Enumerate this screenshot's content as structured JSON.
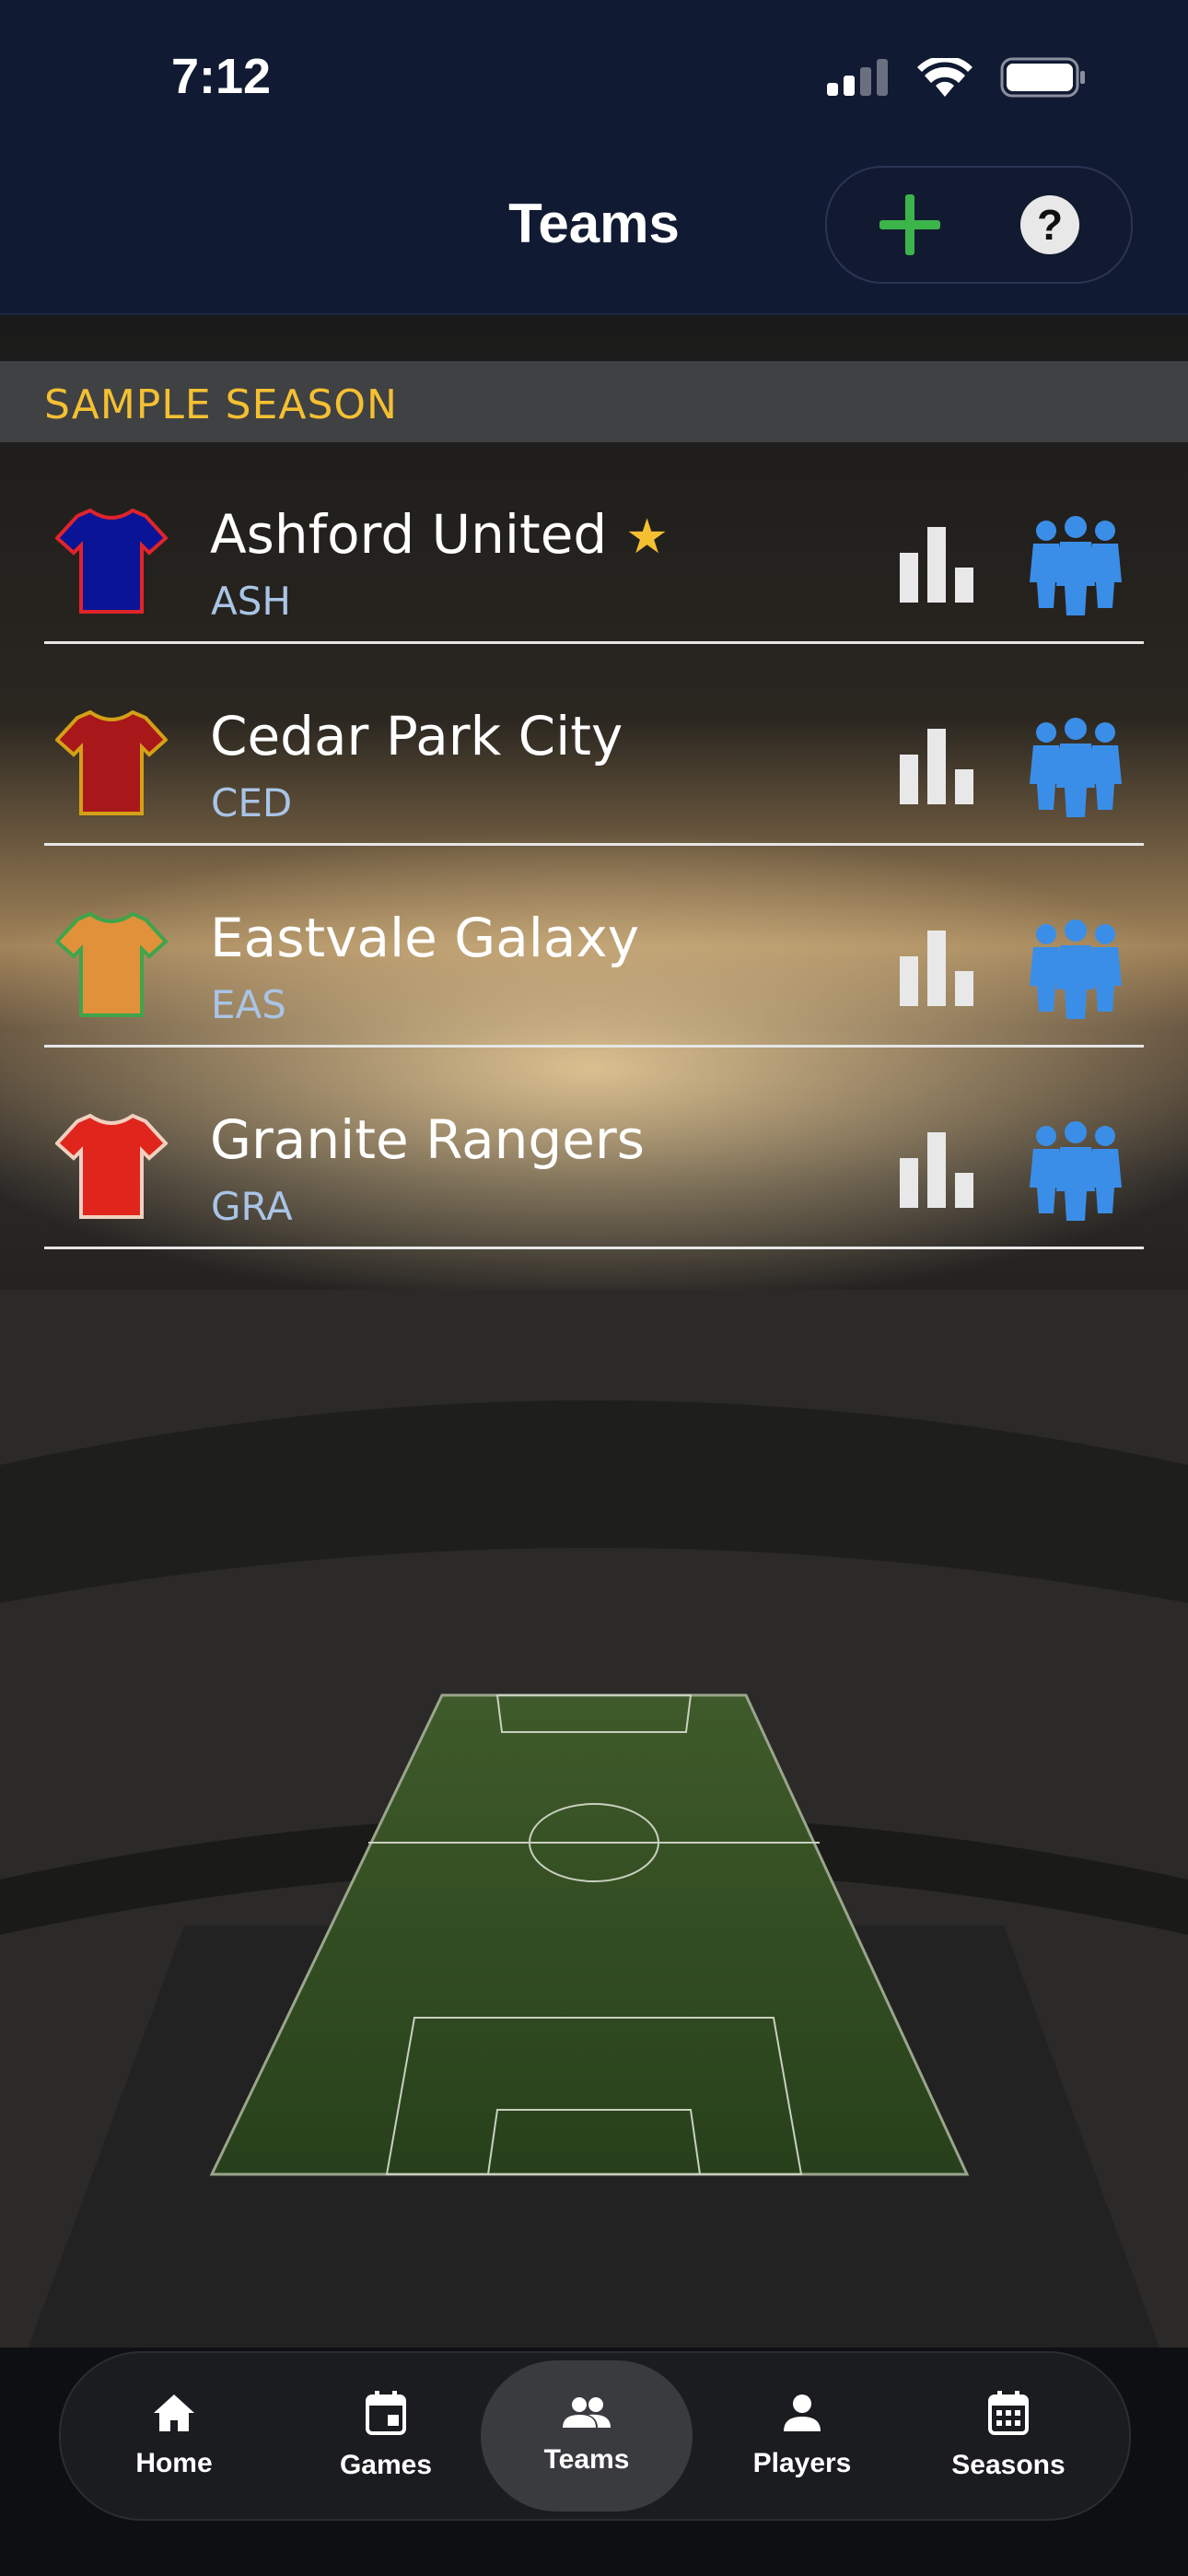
{
  "status_bar": {
    "time": "7:12"
  },
  "nav": {
    "title": "Teams",
    "add_icon": "plus-icon",
    "help_label": "?"
  },
  "season": {
    "label": "SAMPLE SEASON"
  },
  "teams": [
    {
      "name": "Ashford United",
      "abbr": "ASH",
      "favorite": true,
      "jersey_color": "#0a1496",
      "trim_color": "#e0242b"
    },
    {
      "name": "Cedar Park City",
      "abbr": "CED",
      "favorite": false,
      "jersey_color": "#a8171a",
      "trim_color": "#d4a017"
    },
    {
      "name": "Eastvale Galaxy",
      "abbr": "EAS",
      "favorite": false,
      "jersey_color": "#e0913a",
      "trim_color": "#3fa44a"
    },
    {
      "name": "Granite Rangers",
      "abbr": "GRA",
      "favorite": false,
      "jersey_color": "#e0261c",
      "trim_color": "#f2d0c0"
    }
  ],
  "tabs": [
    {
      "label": "Home",
      "icon": "home-icon",
      "active": false
    },
    {
      "label": "Games",
      "icon": "calendar-icon",
      "active": false
    },
    {
      "label": "Teams",
      "icon": "teams-icon",
      "active": true
    },
    {
      "label": "Players",
      "icon": "person-icon",
      "active": false
    },
    {
      "label": "Seasons",
      "icon": "calendar-grid-icon",
      "active": false
    }
  ],
  "colors": {
    "accent": "#f4c032",
    "roster_blue": "#3b8ee8",
    "add_green": "#3bb44a",
    "nav_bg": "#111a33"
  }
}
